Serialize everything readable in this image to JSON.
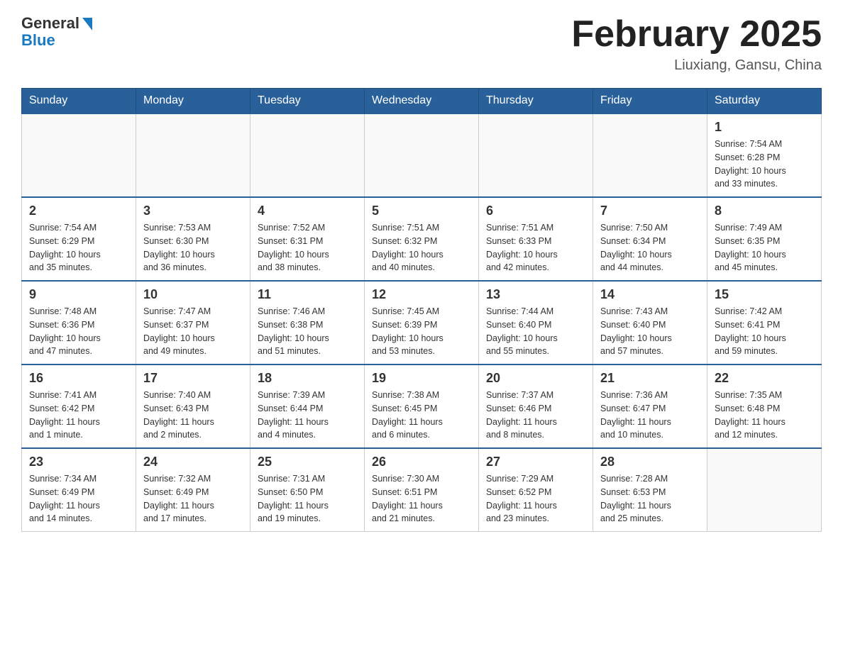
{
  "header": {
    "logo_general": "General",
    "logo_blue": "Blue",
    "month_title": "February 2025",
    "location": "Liuxiang, Gansu, China"
  },
  "days_of_week": [
    "Sunday",
    "Monday",
    "Tuesday",
    "Wednesday",
    "Thursday",
    "Friday",
    "Saturday"
  ],
  "weeks": [
    [
      {
        "day": "",
        "info": ""
      },
      {
        "day": "",
        "info": ""
      },
      {
        "day": "",
        "info": ""
      },
      {
        "day": "",
        "info": ""
      },
      {
        "day": "",
        "info": ""
      },
      {
        "day": "",
        "info": ""
      },
      {
        "day": "1",
        "info": "Sunrise: 7:54 AM\nSunset: 6:28 PM\nDaylight: 10 hours\nand 33 minutes."
      }
    ],
    [
      {
        "day": "2",
        "info": "Sunrise: 7:54 AM\nSunset: 6:29 PM\nDaylight: 10 hours\nand 35 minutes."
      },
      {
        "day": "3",
        "info": "Sunrise: 7:53 AM\nSunset: 6:30 PM\nDaylight: 10 hours\nand 36 minutes."
      },
      {
        "day": "4",
        "info": "Sunrise: 7:52 AM\nSunset: 6:31 PM\nDaylight: 10 hours\nand 38 minutes."
      },
      {
        "day": "5",
        "info": "Sunrise: 7:51 AM\nSunset: 6:32 PM\nDaylight: 10 hours\nand 40 minutes."
      },
      {
        "day": "6",
        "info": "Sunrise: 7:51 AM\nSunset: 6:33 PM\nDaylight: 10 hours\nand 42 minutes."
      },
      {
        "day": "7",
        "info": "Sunrise: 7:50 AM\nSunset: 6:34 PM\nDaylight: 10 hours\nand 44 minutes."
      },
      {
        "day": "8",
        "info": "Sunrise: 7:49 AM\nSunset: 6:35 PM\nDaylight: 10 hours\nand 45 minutes."
      }
    ],
    [
      {
        "day": "9",
        "info": "Sunrise: 7:48 AM\nSunset: 6:36 PM\nDaylight: 10 hours\nand 47 minutes."
      },
      {
        "day": "10",
        "info": "Sunrise: 7:47 AM\nSunset: 6:37 PM\nDaylight: 10 hours\nand 49 minutes."
      },
      {
        "day": "11",
        "info": "Sunrise: 7:46 AM\nSunset: 6:38 PM\nDaylight: 10 hours\nand 51 minutes."
      },
      {
        "day": "12",
        "info": "Sunrise: 7:45 AM\nSunset: 6:39 PM\nDaylight: 10 hours\nand 53 minutes."
      },
      {
        "day": "13",
        "info": "Sunrise: 7:44 AM\nSunset: 6:40 PM\nDaylight: 10 hours\nand 55 minutes."
      },
      {
        "day": "14",
        "info": "Sunrise: 7:43 AM\nSunset: 6:40 PM\nDaylight: 10 hours\nand 57 minutes."
      },
      {
        "day": "15",
        "info": "Sunrise: 7:42 AM\nSunset: 6:41 PM\nDaylight: 10 hours\nand 59 minutes."
      }
    ],
    [
      {
        "day": "16",
        "info": "Sunrise: 7:41 AM\nSunset: 6:42 PM\nDaylight: 11 hours\nand 1 minute."
      },
      {
        "day": "17",
        "info": "Sunrise: 7:40 AM\nSunset: 6:43 PM\nDaylight: 11 hours\nand 2 minutes."
      },
      {
        "day": "18",
        "info": "Sunrise: 7:39 AM\nSunset: 6:44 PM\nDaylight: 11 hours\nand 4 minutes."
      },
      {
        "day": "19",
        "info": "Sunrise: 7:38 AM\nSunset: 6:45 PM\nDaylight: 11 hours\nand 6 minutes."
      },
      {
        "day": "20",
        "info": "Sunrise: 7:37 AM\nSunset: 6:46 PM\nDaylight: 11 hours\nand 8 minutes."
      },
      {
        "day": "21",
        "info": "Sunrise: 7:36 AM\nSunset: 6:47 PM\nDaylight: 11 hours\nand 10 minutes."
      },
      {
        "day": "22",
        "info": "Sunrise: 7:35 AM\nSunset: 6:48 PM\nDaylight: 11 hours\nand 12 minutes."
      }
    ],
    [
      {
        "day": "23",
        "info": "Sunrise: 7:34 AM\nSunset: 6:49 PM\nDaylight: 11 hours\nand 14 minutes."
      },
      {
        "day": "24",
        "info": "Sunrise: 7:32 AM\nSunset: 6:49 PM\nDaylight: 11 hours\nand 17 minutes."
      },
      {
        "day": "25",
        "info": "Sunrise: 7:31 AM\nSunset: 6:50 PM\nDaylight: 11 hours\nand 19 minutes."
      },
      {
        "day": "26",
        "info": "Sunrise: 7:30 AM\nSunset: 6:51 PM\nDaylight: 11 hours\nand 21 minutes."
      },
      {
        "day": "27",
        "info": "Sunrise: 7:29 AM\nSunset: 6:52 PM\nDaylight: 11 hours\nand 23 minutes."
      },
      {
        "day": "28",
        "info": "Sunrise: 7:28 AM\nSunset: 6:53 PM\nDaylight: 11 hours\nand 25 minutes."
      },
      {
        "day": "",
        "info": ""
      }
    ]
  ]
}
